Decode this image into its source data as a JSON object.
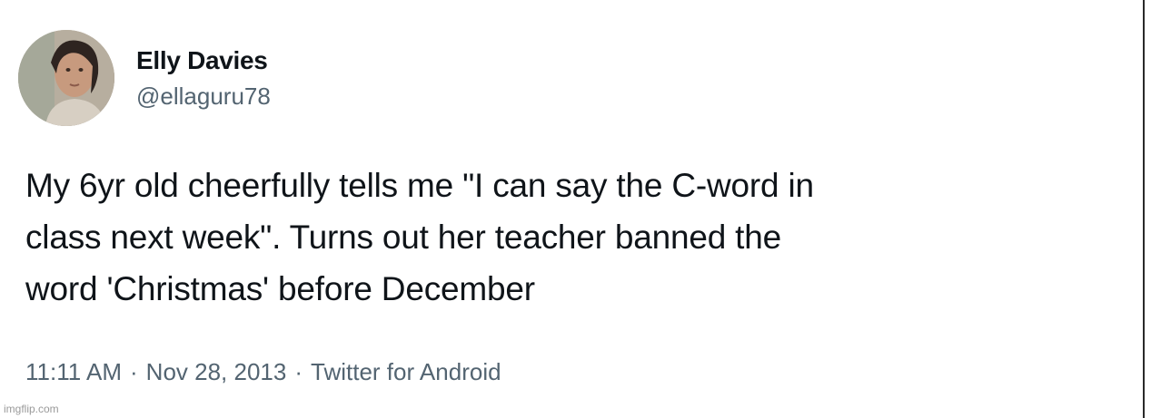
{
  "user": {
    "display_name": "Elly Davies",
    "handle": "@ellaguru78",
    "avatar_icon": "profile-photo"
  },
  "tweet": {
    "text": "My 6yr old cheerfully tells me \"I can say the C-word in\nclass next week\". Turns out her teacher banned the\nword 'Christmas' before December"
  },
  "meta": {
    "time": "11:11 AM",
    "separator": "·",
    "date": "Nov 28, 2013",
    "source": "Twitter for Android"
  },
  "watermark": {
    "text": "imgflip.com"
  },
  "colors": {
    "text_primary": "#0f1419",
    "text_secondary": "#536471",
    "background": "#ffffff"
  }
}
